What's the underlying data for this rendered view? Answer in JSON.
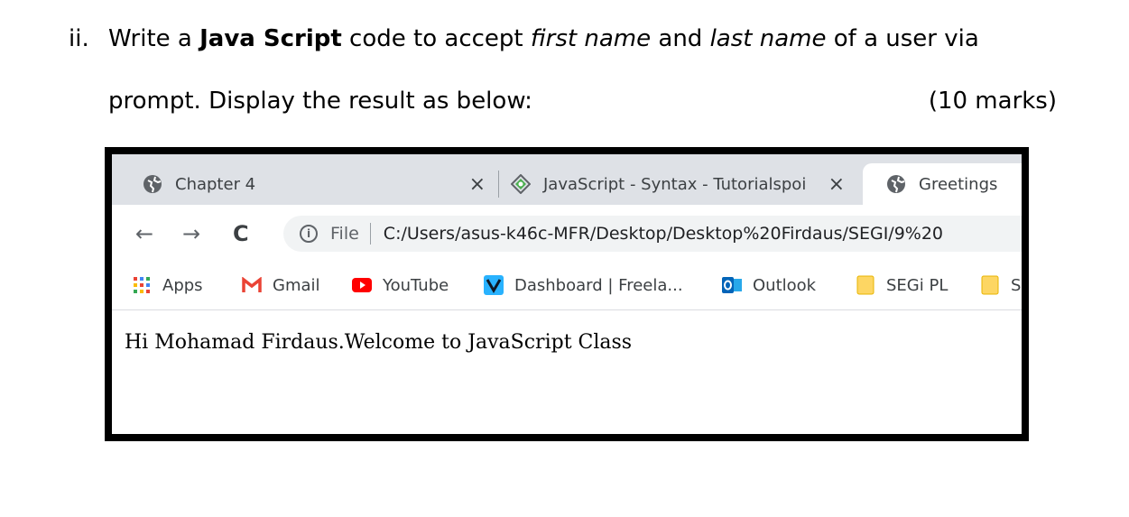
{
  "question": {
    "number": "ii.",
    "line1_part1": "Write a ",
    "line1_bold": "Java Script",
    "line1_part2": " code to accept ",
    "line1_italic1": "first name",
    "line1_part3": " and ",
    "line1_italic2": "last name",
    "line1_part4": " of a user via",
    "line2": "prompt. Display the result as below:",
    "marks": "(10 marks)"
  },
  "browser": {
    "tabs": [
      {
        "label": "Chapter 4",
        "close": "×"
      },
      {
        "label": "JavaScript - Syntax - Tutorialspoi",
        "close": "×"
      },
      {
        "label": "Greetings"
      }
    ],
    "nav": {
      "back": "←",
      "forward": "→",
      "reload": "C"
    },
    "address": {
      "info": "i",
      "chip": "File",
      "url": "C:/Users/asus-k46c-MFR/Desktop/Desktop%20Firdaus/SEGI/9%20"
    },
    "bookmarks": [
      {
        "label": "Apps",
        "icon": "apps-grid-icon"
      },
      {
        "label": "Gmail",
        "icon": "gmail-icon"
      },
      {
        "label": "YouTube",
        "icon": "youtube-icon"
      },
      {
        "label": "Dashboard | Freela...",
        "icon": "freelancer-icon"
      },
      {
        "label": "Outlook",
        "icon": "outlook-icon"
      },
      {
        "label": "SEGi PL",
        "icon": "folder-icon"
      },
      {
        "label": "SE",
        "icon": "folder-icon"
      }
    ],
    "page_text": "Hi Mohamad Firdaus.Welcome to JavaScript Class"
  }
}
